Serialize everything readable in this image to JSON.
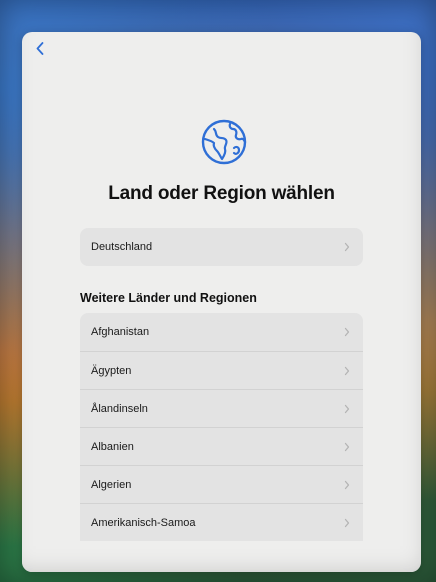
{
  "nav": {
    "back_icon": "chevron-left-icon"
  },
  "header": {
    "icon": "globe-icon",
    "title": "Land oder Region wählen"
  },
  "current": {
    "label": "Deutschland"
  },
  "more": {
    "title": "Weitere Länder und Regionen",
    "items": [
      {
        "label": "Afghanistan"
      },
      {
        "label": "Ägypten"
      },
      {
        "label": "Ålandinseln"
      },
      {
        "label": "Albanien"
      },
      {
        "label": "Algerien"
      },
      {
        "label": "Amerikanisch-Samoa"
      }
    ]
  },
  "colors": {
    "accent": "#2f6fd6",
    "sheet_bg": "#eeeeed",
    "row_bg": "#e3e3e3"
  }
}
